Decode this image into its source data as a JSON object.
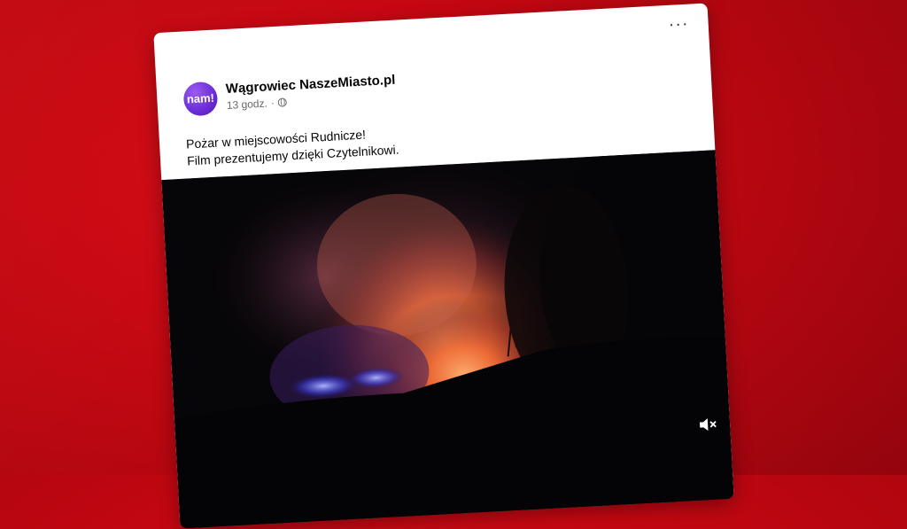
{
  "post": {
    "page_name": "Wągrowiec NaszeMiasto.pl",
    "time": "13 godz.",
    "separator": "·",
    "text_line1": "Pożar w miejscowości Rudnicze!",
    "text_line2": "Film prezentujemy dzięki Czytelnikowi.",
    "avatar_text": "nam!",
    "more_label": "···"
  },
  "icons": {
    "more": "more-options-icon",
    "privacy": "globe-icon",
    "mute": "speaker-muted-icon"
  },
  "colors": {
    "background": "#c50712",
    "card": "#ffffff",
    "avatar": "#6a2bd6",
    "fire": "#ff6a2a"
  }
}
